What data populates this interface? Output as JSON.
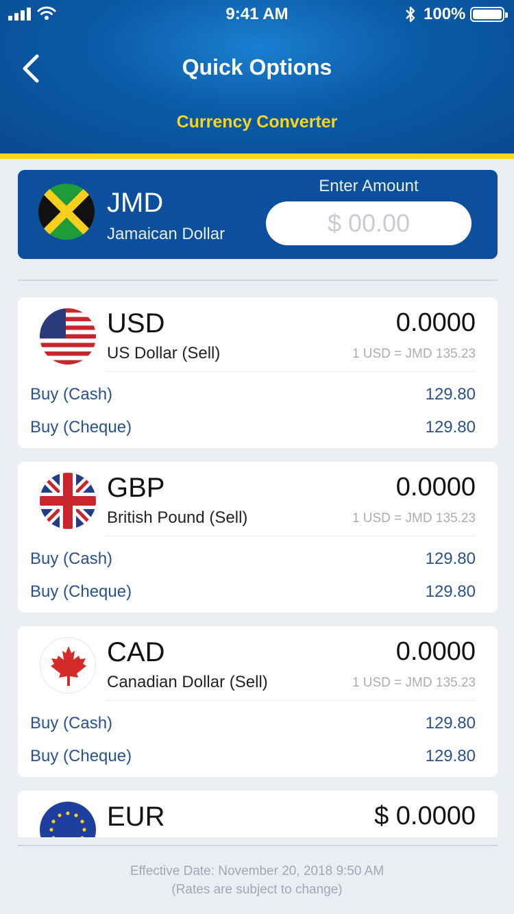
{
  "status_bar": {
    "time": "9:41 AM",
    "battery": "100%"
  },
  "header": {
    "title": "Quick Options",
    "subtitle": "Currency Converter"
  },
  "source": {
    "code": "JMD",
    "name": "Jamaican Dollar",
    "flag_icon": "jamaica-flag-icon",
    "amount_label": "Enter Amount",
    "amount_placeholder": "$ 00.00"
  },
  "currencies": [
    {
      "code": "USD",
      "name": "US Dollar (Sell)",
      "flag_icon": "usa-flag-icon",
      "value": "0.0000",
      "rate": "1 USD = JMD 135.23",
      "buy_cash_label": "Buy (Cash)",
      "buy_cash": "129.80",
      "buy_cheque_label": "Buy (Cheque)",
      "buy_cheque": "129.80"
    },
    {
      "code": "GBP",
      "name": "British Pound (Sell)",
      "flag_icon": "uk-flag-icon",
      "value": "0.0000",
      "rate": "1 USD = JMD 135.23",
      "buy_cash_label": "Buy (Cash)",
      "buy_cash": "129.80",
      "buy_cheque_label": "Buy (Cheque)",
      "buy_cheque": "129.80"
    },
    {
      "code": "CAD",
      "name": "Canadian Dollar (Sell)",
      "flag_icon": "canada-flag-icon",
      "value": "0.0000",
      "rate": "1 USD = JMD 135.23",
      "buy_cash_label": "Buy (Cash)",
      "buy_cash": "129.80",
      "buy_cheque_label": "Buy (Cheque)",
      "buy_cheque": "129.80"
    },
    {
      "code": "EUR",
      "flag_icon": "eu-flag-icon",
      "value": "$ 0.0000"
    }
  ],
  "footer": {
    "effective_date": "Effective Date: November 20, 2018 9:50 AM",
    "disclaimer": "(Rates are subject to change)"
  },
  "colors": {
    "header_blue": "#0a5aa6",
    "accent_yellow": "#f6d51a",
    "source_card_blue": "#0c4f9d",
    "buy_text": "#27518f"
  }
}
